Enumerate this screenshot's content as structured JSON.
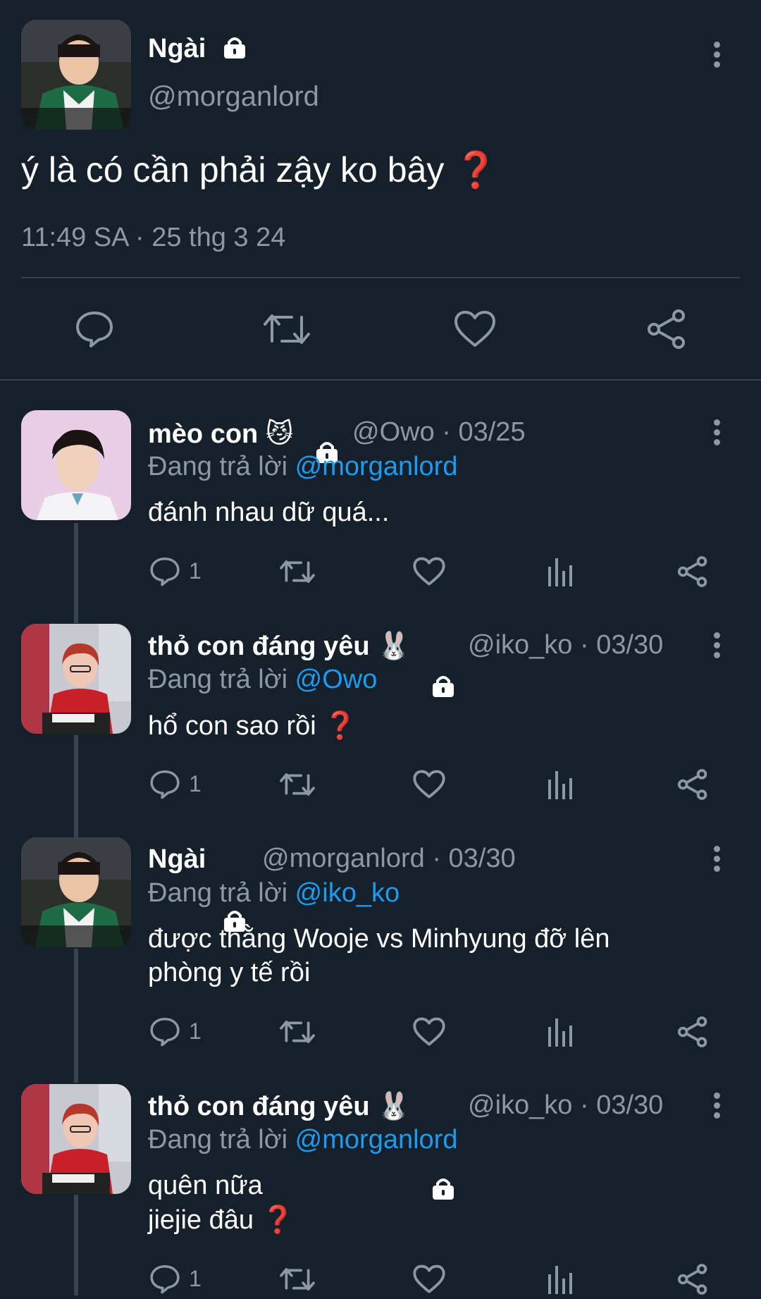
{
  "main_tweet": {
    "display_name": "Ngài",
    "handle": "@morganlord",
    "text": "ý là có cần phải zậy ko bây ❓",
    "timestamp": "11:49 SA · 25 thg 3 24",
    "icons": [
      "lock-icon",
      "more-icon",
      "reply-icon",
      "retweet-icon",
      "like-icon",
      "share-icon"
    ]
  },
  "replies": [
    {
      "display_name": "mèo con 😼",
      "handle_date": "@Owo · 03/25",
      "replying_prefix": "Đang trả lời",
      "replying_to": "@morganlord",
      "text": "đánh nhau dữ quá...",
      "reply_count": "1"
    },
    {
      "display_name": "thỏ con đáng yêu 🐰",
      "handle_date": "@iko_ko · 03/30",
      "replying_prefix": "Đang trả lời",
      "replying_to": "@Owo",
      "text": "hổ con sao rồi ❓",
      "reply_count": "1"
    },
    {
      "display_name": "Ngài",
      "handle_date": "@morganlord · 03/30",
      "replying_prefix": "Đang trả lời",
      "replying_to": "@iko_ko",
      "text_line1": "được thằng Wooje vs Minhyung đỡ lên",
      "text_line2": "phòng y tế rồi",
      "reply_count": "1"
    },
    {
      "display_name": "thỏ con đáng yêu 🐰",
      "handle_date": "@iko_ko · 03/30",
      "replying_prefix": "Đang trả lời",
      "replying_to": "@morganlord",
      "text_line1": "quên nữa",
      "text_line2": "jiejie đâu ❓",
      "reply_count": "1"
    }
  ],
  "colors": {
    "background": "#15202b",
    "text": "#ffffff",
    "muted": "#8b98a5",
    "link": "#1d9bf0",
    "divider": "#38444d"
  }
}
